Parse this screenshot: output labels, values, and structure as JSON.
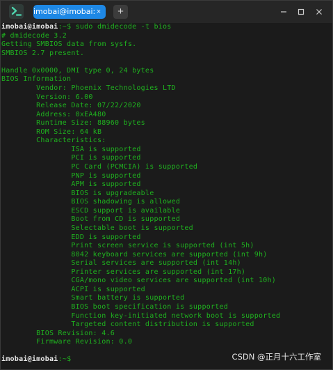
{
  "window": {
    "tab_title": "imobai@imobai: ~",
    "tab_close": "×",
    "new_tab": "+",
    "minimize": "—",
    "maximize": "☐",
    "close": "✕"
  },
  "terminal": {
    "prompt_user": "imobai@imobai",
    "first_command": ":~$ sudo dmidecode -t bios",
    "lines": [
      "# dmidecode 3.2",
      "Getting SMBIOS data from sysfs.",
      "SMBIOS 2.7 present.",
      "",
      "Handle 0x0000, DMI type 0, 24 bytes",
      "BIOS Information",
      "        Vendor: Phoenix Technologies LTD",
      "        Version: 6.00",
      "        Release Date: 07/22/2020",
      "        Address: 0xEA480",
      "        Runtime Size: 88960 bytes",
      "        ROM Size: 64 kB",
      "        Characteristics:",
      "                ISA is supported",
      "                PCI is supported",
      "                PC Card (PCMCIA) is supported",
      "                PNP is supported",
      "                APM is supported",
      "                BIOS is upgradeable",
      "                BIOS shadowing is allowed",
      "                ESCD support is available",
      "                Boot from CD is supported",
      "                Selectable boot is supported",
      "                EDD is supported",
      "                Print screen service is supported (int 5h)",
      "                8042 keyboard services are supported (int 9h)",
      "                Serial services are supported (int 14h)",
      "                Printer services are supported (int 17h)",
      "                CGA/mono video services are supported (int 10h)",
      "                ACPI is supported",
      "                Smart battery is supported",
      "                BIOS boot specification is supported",
      "                Function key-initiated network boot is supported",
      "                Targeted content distribution is supported",
      "        BIOS Revision: 4.6",
      "        Firmware Revision: 0.0",
      ""
    ],
    "last_prompt": ":~$"
  },
  "watermark": "CSDN @正月十六工作室",
  "colors": {
    "background": "#1b1b1b",
    "text_green": "#1fb21f",
    "tab_blue": "#1e88e5",
    "titlebar": "#262626"
  }
}
